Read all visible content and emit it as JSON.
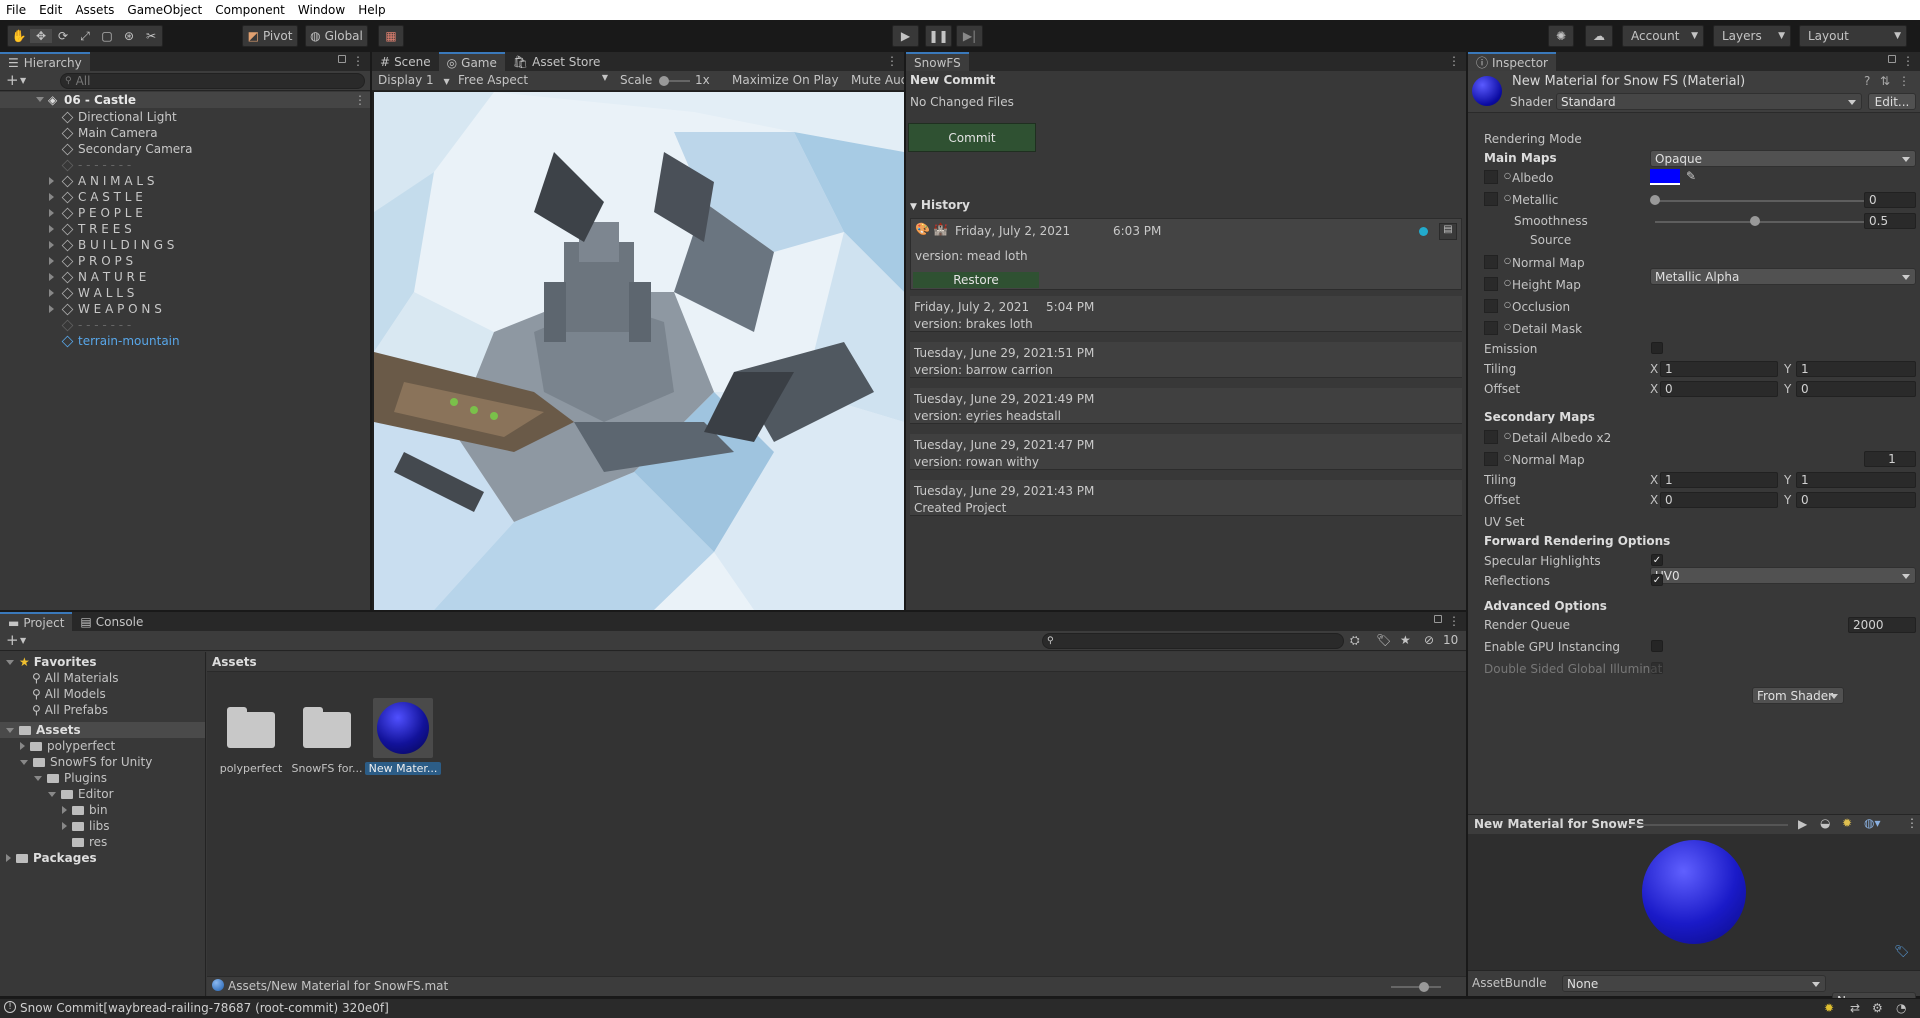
{
  "menu": [
    "File",
    "Edit",
    "Assets",
    "GameObject",
    "Component",
    "Window",
    "Help"
  ],
  "toolbar": {
    "pivot_label": "Pivot",
    "global_label": "Global",
    "account_label": "Account",
    "layers_label": "Layers",
    "layout_label": "Layout"
  },
  "hierarchy": {
    "tab": "Hierarchy",
    "search_placeholder": "All",
    "scene_name": "06 - Castle",
    "items": [
      {
        "label": "Directional Light",
        "expandable": false
      },
      {
        "label": "Main Camera",
        "expandable": false
      },
      {
        "label": "Secondary Camera",
        "expandable": false
      },
      {
        "label": "- - - - - - -",
        "expandable": false,
        "dim": true
      },
      {
        "label": "A N I M A L S",
        "expandable": true
      },
      {
        "label": "C A S T L E",
        "expandable": true
      },
      {
        "label": "P E O P L E",
        "expandable": true
      },
      {
        "label": "T R E E S",
        "expandable": true
      },
      {
        "label": "B U I L D I N G S",
        "expandable": true
      },
      {
        "label": "P R O P S",
        "expandable": true
      },
      {
        "label": "N A T U R E",
        "expandable": true
      },
      {
        "label": "W A L L S",
        "expandable": true
      },
      {
        "label": "W E A P O N S",
        "expandable": true
      },
      {
        "label": "- - - - - - -",
        "expandable": false,
        "dim": true
      },
      {
        "label": "terrain-mountain",
        "expandable": false,
        "blue": true
      }
    ]
  },
  "game": {
    "tabs": [
      "Scene",
      "Game",
      "Asset Store"
    ],
    "display": "Display 1",
    "aspect": "Free Aspect",
    "scale_label": "Scale",
    "scale_value": "1x",
    "maximize_label": "Maximize On Play",
    "mute_label": "Mute Auc"
  },
  "snowfs": {
    "tab": "SnowFS",
    "new_commit": "New Commit",
    "no_changes": "No Changed Files",
    "commit_button": "Commit",
    "history_label": "History",
    "current": {
      "date": "Friday, July 2, 2021",
      "time": "6:03 PM",
      "version": "version: mead loth",
      "restore": "Restore"
    },
    "entries": [
      {
        "date": "Friday, July 2, 2021",
        "time": "5:04 PM",
        "version": "version: brakes loth"
      },
      {
        "date": "Tuesday, June 29, 2021",
        "time": "1:51 PM",
        "version": "version: barrow carrion"
      },
      {
        "date": "Tuesday, June 29, 2021",
        "time": "1:49 PM",
        "version": "version: eyries headstall"
      },
      {
        "date": "Tuesday, June 29, 2021",
        "time": "1:47 PM",
        "version": "version: rowan withy"
      },
      {
        "date": "Tuesday, June 29, 2021",
        "time": "1:43 PM",
        "version": "Created Project"
      }
    ]
  },
  "inspector": {
    "tab": "Inspector",
    "title": "New Material for Snow FS (Material)",
    "shader_label": "Shader",
    "shader_value": "Standard",
    "edit_label": "Edit...",
    "rendering_mode_label": "Rendering Mode",
    "rendering_mode_value": "Opaque",
    "main_maps": "Main Maps",
    "albedo": "Albedo",
    "albedo_color": "#0000ff",
    "metallic": "Metallic",
    "metallic_value": "0",
    "metallic_level": 0,
    "smoothness": "Smoothness",
    "smoothness_value": "0.5",
    "smoothness_level": 0.5,
    "source": "Source",
    "source_value": "Metallic Alpha",
    "normal_map": "Normal Map",
    "height_map": "Height Map",
    "occlusion": "Occlusion",
    "detail_mask": "Detail Mask",
    "emission": "Emission",
    "tiling": "Tiling",
    "offset": "Offset",
    "x": "X",
    "y": "Y",
    "tiling_x": "1",
    "tiling_y": "1",
    "offset_x": "0",
    "offset_y": "0",
    "secondary_maps": "Secondary Maps",
    "detail_albedo": "Detail Albedo x2",
    "normal_map2": "Normal Map",
    "normal_map2_value": "1",
    "tiling2_x": "1",
    "tiling2_y": "1",
    "offset2_x": "0",
    "offset2_y": "0",
    "uv_set": "UV Set",
    "uv_set_value": "UV0",
    "forward_options": "Forward Rendering Options",
    "specular": "Specular Highlights",
    "reflections": "Reflections",
    "advanced": "Advanced Options",
    "render_queue": "Render Queue",
    "render_queue_mode": "From Shader",
    "render_queue_value": "2000",
    "gpu_instancing": "Enable GPU Instancing",
    "double_sided": "Double Sided Global Illuminat",
    "preview_title": "New Material for SnowFS",
    "assetbundle_label": "AssetBundle",
    "assetbundle_value": "None",
    "assetbundle_variant": "None"
  },
  "project": {
    "tabs": [
      "Project",
      "Console"
    ],
    "hidden_count": "10",
    "favorites": "Favorites",
    "fav_items": [
      "All Materials",
      "All Models",
      "All Prefabs"
    ],
    "assets_root": "Assets",
    "tree": [
      {
        "label": "polyperfect",
        "indent": 1,
        "arrow": "right"
      },
      {
        "label": "SnowFS for Unity",
        "indent": 1,
        "arrow": "down"
      },
      {
        "label": "Plugins",
        "indent": 2,
        "arrow": "down"
      },
      {
        "label": "Editor",
        "indent": 3,
        "arrow": "down"
      },
      {
        "label": "bin",
        "indent": 4,
        "arrow": "right"
      },
      {
        "label": "libs",
        "indent": 4,
        "arrow": "right"
      },
      {
        "label": "res",
        "indent": 4,
        "arrow": "none"
      }
    ],
    "packages": "Packages",
    "breadcrumb": "Assets",
    "assets": [
      {
        "label": "polyperfect",
        "kind": "folder"
      },
      {
        "label": "SnowFS for...",
        "kind": "folder"
      },
      {
        "label": "New Mater...",
        "kind": "material"
      }
    ],
    "selected_path": "Assets/New Material for SnowFS.mat"
  },
  "status_bar": {
    "text": "Snow Commit[waybread-railing-78687 (root-commit) 320e0f]"
  }
}
